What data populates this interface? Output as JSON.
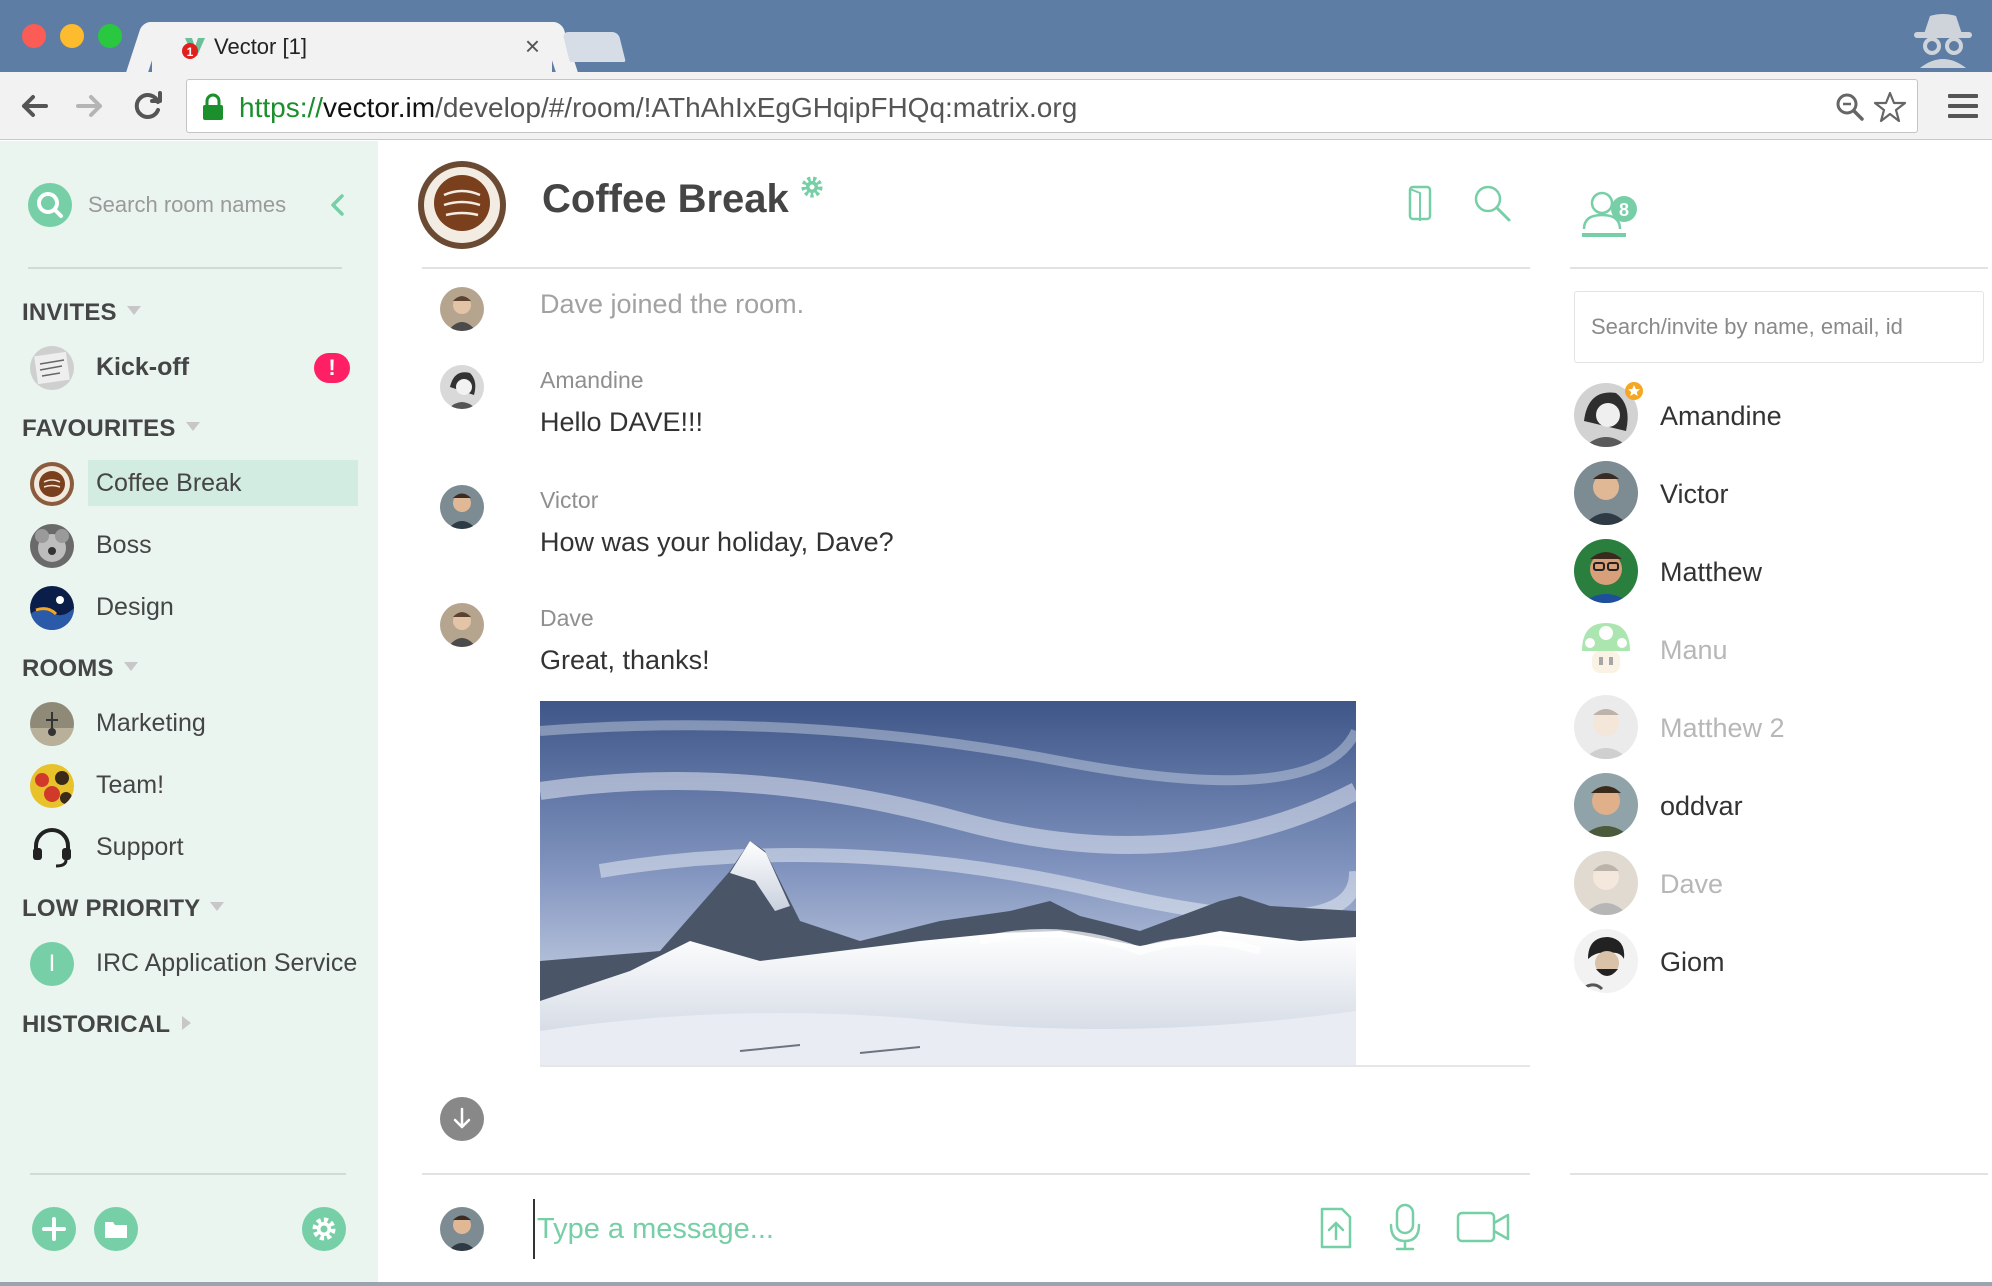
{
  "browser": {
    "tab_title": "Vector [1]",
    "tab_close": "×",
    "url_scheme": "https://",
    "url_host": "vector.im",
    "url_path": "/develop/#/room/!AThAhIxEgGHqipFHQq:matrix.org",
    "tab_badge": "1"
  },
  "sidebar": {
    "search_placeholder": "Search room names",
    "sections": {
      "invites": "INVITES",
      "favourites": "FAVOURITES",
      "rooms": "ROOMS",
      "low_priority": "LOW PRIORITY",
      "historical": "HISTORICAL"
    },
    "invites": [
      {
        "name": "Kick-off",
        "badge": "!"
      }
    ],
    "favourites": [
      {
        "name": "Coffee Break"
      },
      {
        "name": "Boss"
      },
      {
        "name": "Design"
      }
    ],
    "rooms": [
      {
        "name": "Marketing"
      },
      {
        "name": "Team!"
      },
      {
        "name": "Support"
      }
    ],
    "low_priority": [
      {
        "name": "IRC Application Service",
        "initial": "I"
      }
    ]
  },
  "room": {
    "title": "Coffee Break"
  },
  "timeline": {
    "events": [
      {
        "type": "notice",
        "text": "Dave joined the room."
      },
      {
        "type": "message",
        "sender": "Amandine",
        "text": "Hello DAVE!!!"
      },
      {
        "type": "message",
        "sender": "Victor",
        "text": "How was your holiday, Dave?"
      },
      {
        "type": "message",
        "sender": "Dave",
        "text": "Great, thanks!"
      }
    ]
  },
  "composer": {
    "placeholder": "Type a message..."
  },
  "members": {
    "count": "8",
    "search_placeholder": "Search/invite by name, email, id",
    "list": [
      {
        "name": "Amandine",
        "online": true
      },
      {
        "name": "Victor",
        "online": true
      },
      {
        "name": "Matthew",
        "online": true
      },
      {
        "name": "Manu",
        "online": false
      },
      {
        "name": "Matthew 2",
        "online": false
      },
      {
        "name": "oddvar",
        "online": true
      },
      {
        "name": "Dave",
        "online": false
      },
      {
        "name": "Giom",
        "online": true
      }
    ]
  },
  "colors": {
    "accent": "#76cfa6",
    "sidebar_bg": "#eaf5f0",
    "selected_room_bg": "#d2ece1",
    "badge": "#ff1f64",
    "browser_frame": "#5d7da4"
  }
}
